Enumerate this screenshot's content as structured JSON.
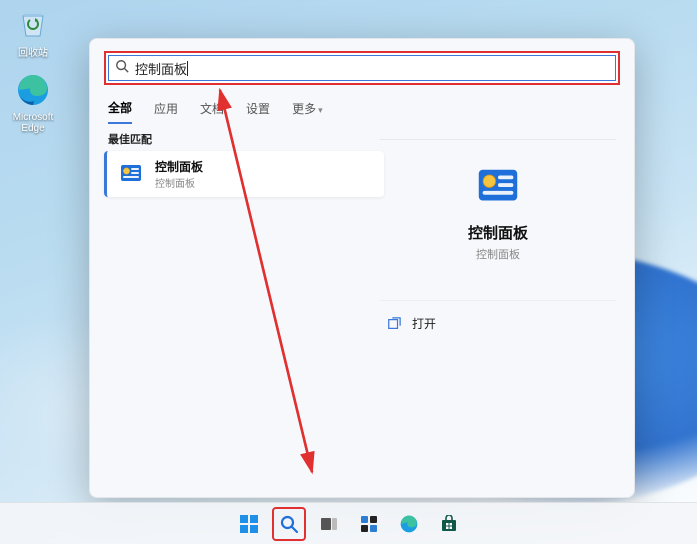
{
  "desktop": {
    "recycle_bin_label": "回收站",
    "edge_label": "Microsoft Edge"
  },
  "search": {
    "query": "控制面板",
    "tabs": {
      "all": "全部",
      "apps": "应用",
      "docs": "文档",
      "settings": "设置",
      "more": "更多"
    },
    "best_match_label": "最佳匹配",
    "result": {
      "title": "控制面板",
      "subtitle": "控制面板"
    },
    "detail": {
      "title": "控制面板",
      "subtitle": "控制面板",
      "open_label": "打开"
    }
  },
  "colors": {
    "highlight_red": "#e03030",
    "accent_blue": "#3b78d8"
  }
}
